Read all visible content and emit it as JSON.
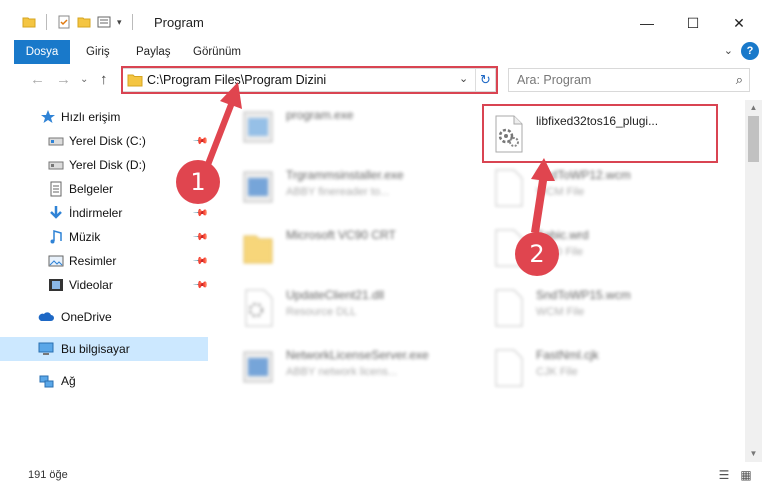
{
  "window": {
    "title": "Program",
    "minimize_glyph": "—",
    "maximize_glyph": "☐",
    "close_glyph": "✕"
  },
  "ribbon": {
    "tabs": [
      "Dosya",
      "Giriş",
      "Paylaş",
      "Görünüm"
    ],
    "help": "?",
    "expand": "⌄"
  },
  "address": {
    "path": "C:\\Program Files\\Program Dizini",
    "dropdown": "⌄",
    "refresh": "↻"
  },
  "search": {
    "placeholder": "Ara: Program",
    "icon": "⌕"
  },
  "nav": {
    "back": "←",
    "forward": "→",
    "recent": "⌄",
    "up": "↑"
  },
  "sidebar": {
    "items": [
      {
        "label": "Hızlı erişim",
        "icon": "star-icon"
      },
      {
        "label": "Yerel Disk (C:)",
        "icon": "drive-icon"
      },
      {
        "label": "Yerel Disk (D:)",
        "icon": "drive-icon"
      },
      {
        "label": "Belgeler",
        "icon": "documents-icon"
      },
      {
        "label": "İndirmeler",
        "icon": "download-icon"
      },
      {
        "label": "Müzik",
        "icon": "music-icon"
      },
      {
        "label": "Resimler",
        "icon": "pictures-icon"
      },
      {
        "label": "Videolar",
        "icon": "videos-icon"
      },
      {
        "label": "OneDrive",
        "icon": "cloud-icon"
      },
      {
        "label": "Bu bilgisayar",
        "icon": "computer-icon"
      },
      {
        "label": "Ağ",
        "icon": "network-icon"
      }
    ],
    "pin_glyph": "📌"
  },
  "files": [
    {
      "name": "program.exe",
      "desc": ""
    },
    {
      "name": "libfixed32tos16_plugi...",
      "desc": ""
    },
    {
      "name": "Trgrammsinstaller.exe",
      "desc": "ABBY finereader to..."
    },
    {
      "name": "SndToWP12.wcm",
      "desc": "WCM File"
    },
    {
      "name": "Microsoft VC90 CRT",
      "desc": ""
    },
    {
      "name": "Sabic.wrd",
      "desc": "WRD File"
    },
    {
      "name": "UpdateClient21.dll",
      "desc": "Resource DLL"
    },
    {
      "name": "SndToWP15.wcm",
      "desc": "WCM File"
    },
    {
      "name": "NetworkLicenseServer.exe",
      "desc": "ABBY network licens..."
    },
    {
      "name": "FastNml.cjk",
      "desc": "CJK File"
    }
  ],
  "status": {
    "count": "191 öğe"
  },
  "annotations": {
    "step1": "1",
    "step2": "2"
  },
  "colors": {
    "accent": "#1979ca",
    "highlight": "#d94452",
    "selection": "#cce8ff"
  }
}
